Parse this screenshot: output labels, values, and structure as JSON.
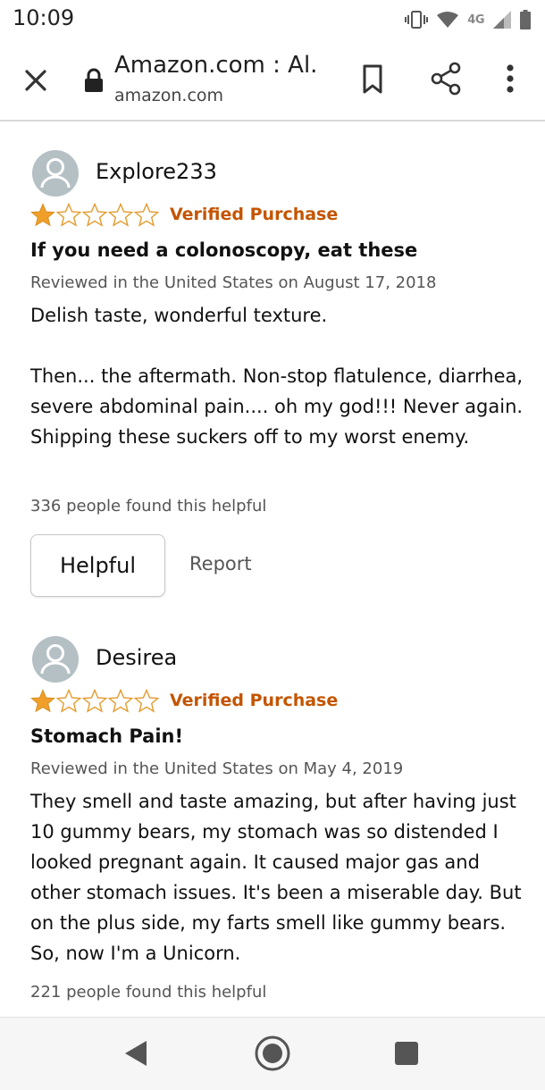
{
  "status_bar": {
    "time": "10:09",
    "network": "4G",
    "icons": [
      "vibrate-icon",
      "wifi-icon",
      "signal-icon",
      "battery-icon"
    ]
  },
  "browser": {
    "page_title": "Amazon.com : Al...",
    "domain": "amazon.com",
    "icons": [
      "close-icon",
      "lock-icon",
      "bookmark-icon",
      "share-icon",
      "more-icon"
    ]
  },
  "colors": {
    "verified": "#c45500",
    "star_filled": "#f0a02a",
    "star_empty_stroke": "#e39a2c",
    "avatar_bg": "#b5c0c5"
  },
  "reviews": [
    {
      "reviewer": "Explore233",
      "rating": 1,
      "rating_max": 5,
      "verified": "Verified Purchase",
      "title": "If you need a colonoscopy, eat these",
      "date_line": "Reviewed in the United States on August 17, 2018",
      "body_paragraphs": [
        "Delish taste, wonderful texture.",
        "Then... the aftermath. Non-stop flatulence, diarrhea, severe abdominal pain.... oh my god!!! Never again. Shipping these suckers off to my worst enemy."
      ],
      "helpful_count": "336 people found this helpful",
      "helpful_button": "Helpful",
      "report_label": "Report"
    },
    {
      "reviewer": "Desirea",
      "rating": 1,
      "rating_max": 5,
      "verified": "Verified Purchase",
      "title": "Stomach Pain!",
      "date_line": "Reviewed in the United States on May 4, 2019",
      "body_paragraphs": [
        "They smell and taste amazing, but after having just 10 gummy bears, my stomach was so distended I looked pregnant again. It caused major gas and other stomach issues. It's been a miserable day. But on the plus side, my farts smell like gummy bears. So, now I'm a Unicorn."
      ],
      "helpful_count": "221 people found this helpful"
    }
  ],
  "nav_bar": {
    "icons": [
      "back-icon",
      "home-icon",
      "recents-icon"
    ]
  }
}
